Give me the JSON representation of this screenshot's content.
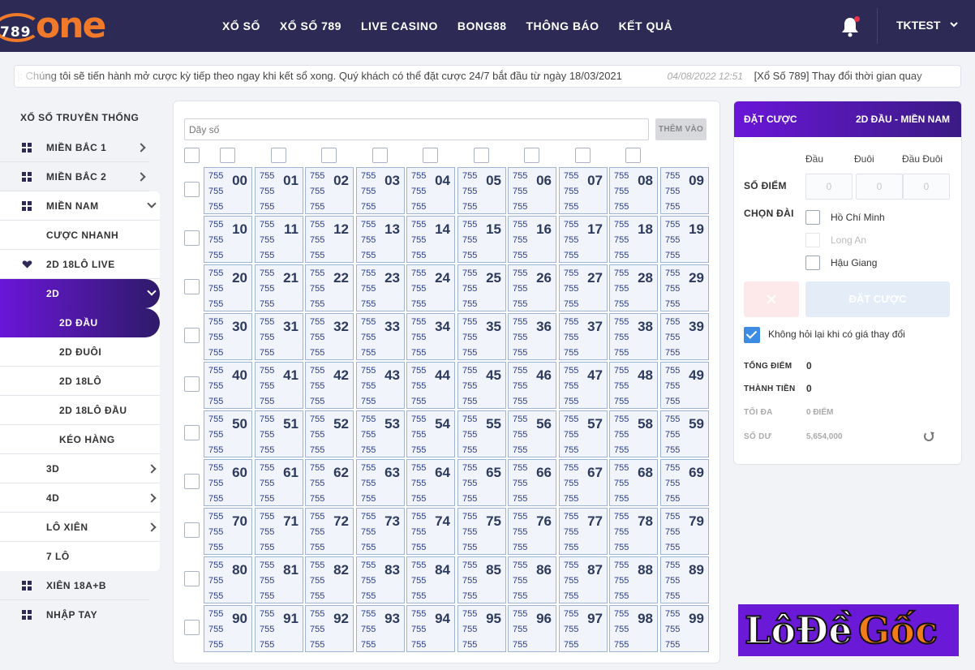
{
  "header": {
    "logo_num": "789",
    "logo_word": "one",
    "nav": [
      "XỔ SỐ",
      "XỔ SỐ 789",
      "LIVE CASINO",
      "BONG88",
      "THÔNG BÁO",
      "KẾT QUẢ"
    ],
    "user": "TKTEST",
    "icons": {
      "bell": "bell-icon",
      "caret": "caret-down-icon"
    },
    "colors": {
      "bg": "#2d2b55",
      "logo": "#f07a2a",
      "badge": "#e8344a"
    }
  },
  "marquee": {
    "text1": "ền Thống]: Chúng tôi sẽ tiến hành mở cược kỳ tiếp theo ngay khi kết sổ xong. Quý khách có thể đặt cược 24/7 bắt đầu từ ngày 18/03/2021",
    "date": "04/08/2022 12:51",
    "text2": "[Xổ Số 789] Thay đổi thời gian quay"
  },
  "sidebar": {
    "title": "XỔ SỐ TRUYỀN THỐNG",
    "mien_bac_1": "MIỀN BẮC 1",
    "mien_bac_2": "MIỀN BẮC 2",
    "mien_nam": "MIỀN NAM",
    "cuoc_nhanh": "CƯỢC NHANH",
    "live": "2D 18LÔ LIVE",
    "d2": "2D",
    "d2_dau": "2D ĐẦU",
    "d2_duoi": "2D ĐUÔI",
    "d2_18lo": "2D 18LÔ",
    "d2_18lo_dau": "2D 18LÔ ĐẦU",
    "keo_hang": "KÉO HÀNG",
    "d3": "3D",
    "d4": "4D",
    "lo_xien": "LÔ XIÊN",
    "lo7": "7 LÔ",
    "xien": "XIÊN 18A+B",
    "nhap_tay": "NHẬP TAY",
    "active_color": "#6a16d8"
  },
  "board": {
    "placeholder": "Dãy số",
    "add_label": "THÊM VÀO",
    "odds": "755",
    "numbers": [
      "00",
      "01",
      "02",
      "03",
      "04",
      "05",
      "06",
      "07",
      "08",
      "09",
      "10",
      "11",
      "12",
      "13",
      "14",
      "15",
      "16",
      "17",
      "18",
      "19",
      "20",
      "21",
      "22",
      "23",
      "24",
      "25",
      "26",
      "27",
      "28",
      "29",
      "30",
      "31",
      "32",
      "33",
      "34",
      "35",
      "36",
      "37",
      "38",
      "39",
      "40",
      "41",
      "42",
      "43",
      "44",
      "45",
      "46",
      "47",
      "48",
      "49",
      "50",
      "51",
      "52",
      "53",
      "54",
      "55",
      "56",
      "57",
      "58",
      "59",
      "60",
      "61",
      "62",
      "63",
      "64",
      "65",
      "66",
      "67",
      "68",
      "69",
      "70",
      "71",
      "72",
      "73",
      "74",
      "75",
      "76",
      "77",
      "78",
      "79",
      "80",
      "81",
      "82",
      "83",
      "84",
      "85",
      "86",
      "87",
      "88",
      "89",
      "90",
      "91",
      "92",
      "93",
      "94",
      "95",
      "96",
      "97",
      "98",
      "99"
    ]
  },
  "panel": {
    "title": "ĐẶT CƯỢC",
    "mode": "2D ĐẦU - MIỀN NAM",
    "col_dau": "Đầu",
    "col_duoi": "Đuôi",
    "col_dauduoi": "Đầu Đuôi",
    "so_diem": "SỐ ĐIỂM",
    "score_ph": "0",
    "chon_dai": "CHỌN ĐÀI",
    "station1": "Hồ Chí Minh",
    "station2": "Long An",
    "station3": "Hậu Giang",
    "bet_label": "ĐẶT CƯỢC",
    "no_ask": "Không hỏi lại khi có giá thay đổi",
    "tong_diem": "TỔNG ĐIỂM",
    "tong_diem_v": "0",
    "thanh_tien": "THÀNH TIỀN",
    "thanh_tien_v": "0",
    "toi_da": "TỐI ĐA",
    "toi_da_v": "0 ĐIỂM",
    "so_du": "SỐ DƯ",
    "so_du_v": "5,654,000",
    "icons": {
      "clear": "close-icon",
      "refresh": "refresh-icon",
      "check": "check-icon"
    }
  },
  "watermark": {
    "a": "LôĐề",
    "b": "Gốc"
  }
}
